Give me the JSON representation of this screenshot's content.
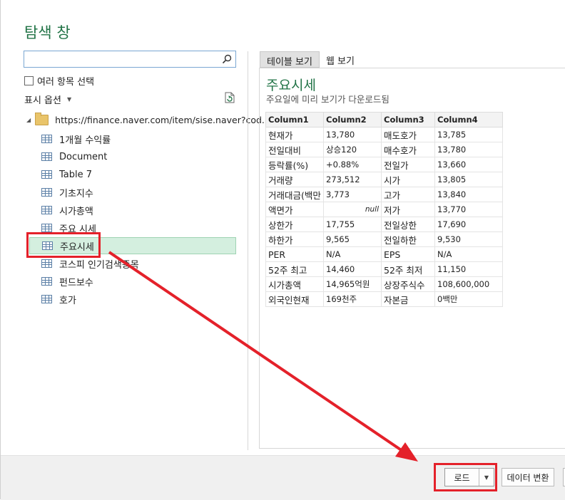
{
  "title": "탐색 창",
  "search": {
    "value": "",
    "placeholder": ""
  },
  "multi_select_label": "여러 항목 선택",
  "display_options_label": "표시 옵션",
  "tree": {
    "root": "https://finance.naver.com/item/sise.naver?cod...",
    "items": [
      "1개월 수익률",
      "Document",
      "Table 7",
      "기초지수",
      "시가총액",
      "주요 시세",
      "주요시세",
      "코스피 인기검색종목",
      "펀드보수",
      "호가"
    ],
    "selected_index": 6
  },
  "tabs": [
    "테이블 보기",
    "웹 보기"
  ],
  "preview": {
    "title": "주요시세",
    "subtitle": "주요일에 미리 보기가 다운로드됨",
    "columns": [
      "Column1",
      "Column2",
      "Column3",
      "Column4"
    ],
    "rows": [
      [
        "현재가",
        "13,780",
        "매도호가",
        "13,785"
      ],
      [
        "전일대비",
        "상승120",
        "매수호가",
        "13,780"
      ],
      [
        "등락률(%)",
        "+0.88%",
        "전일가",
        "13,660"
      ],
      [
        "거래량",
        "273,512",
        "시가",
        "13,805"
      ],
      [
        "거래대금(백만",
        "3,773",
        "고가",
        "13,840"
      ],
      [
        "액면가",
        "null",
        "저가",
        "13,770"
      ],
      [
        "상한가",
        "17,755",
        "전일상한",
        "17,690"
      ],
      [
        "하한가",
        "9,565",
        "전일하한",
        "9,530"
      ],
      [
        "PER",
        "N/A",
        "EPS",
        "N/A"
      ],
      [
        "52주 최고",
        "14,460",
        "52주 최저",
        "11,150"
      ],
      [
        "시가총액",
        "14,965억원",
        "상장주식수",
        "108,600,000"
      ],
      [
        "외국인현재",
        "169천주",
        "자본금",
        "0백만"
      ]
    ]
  },
  "buttons": {
    "load": "로드",
    "transform": "데이터 변환"
  },
  "colors": {
    "accent": "#217346",
    "highlight": "#e4212a",
    "selection": "#d4efdf"
  }
}
